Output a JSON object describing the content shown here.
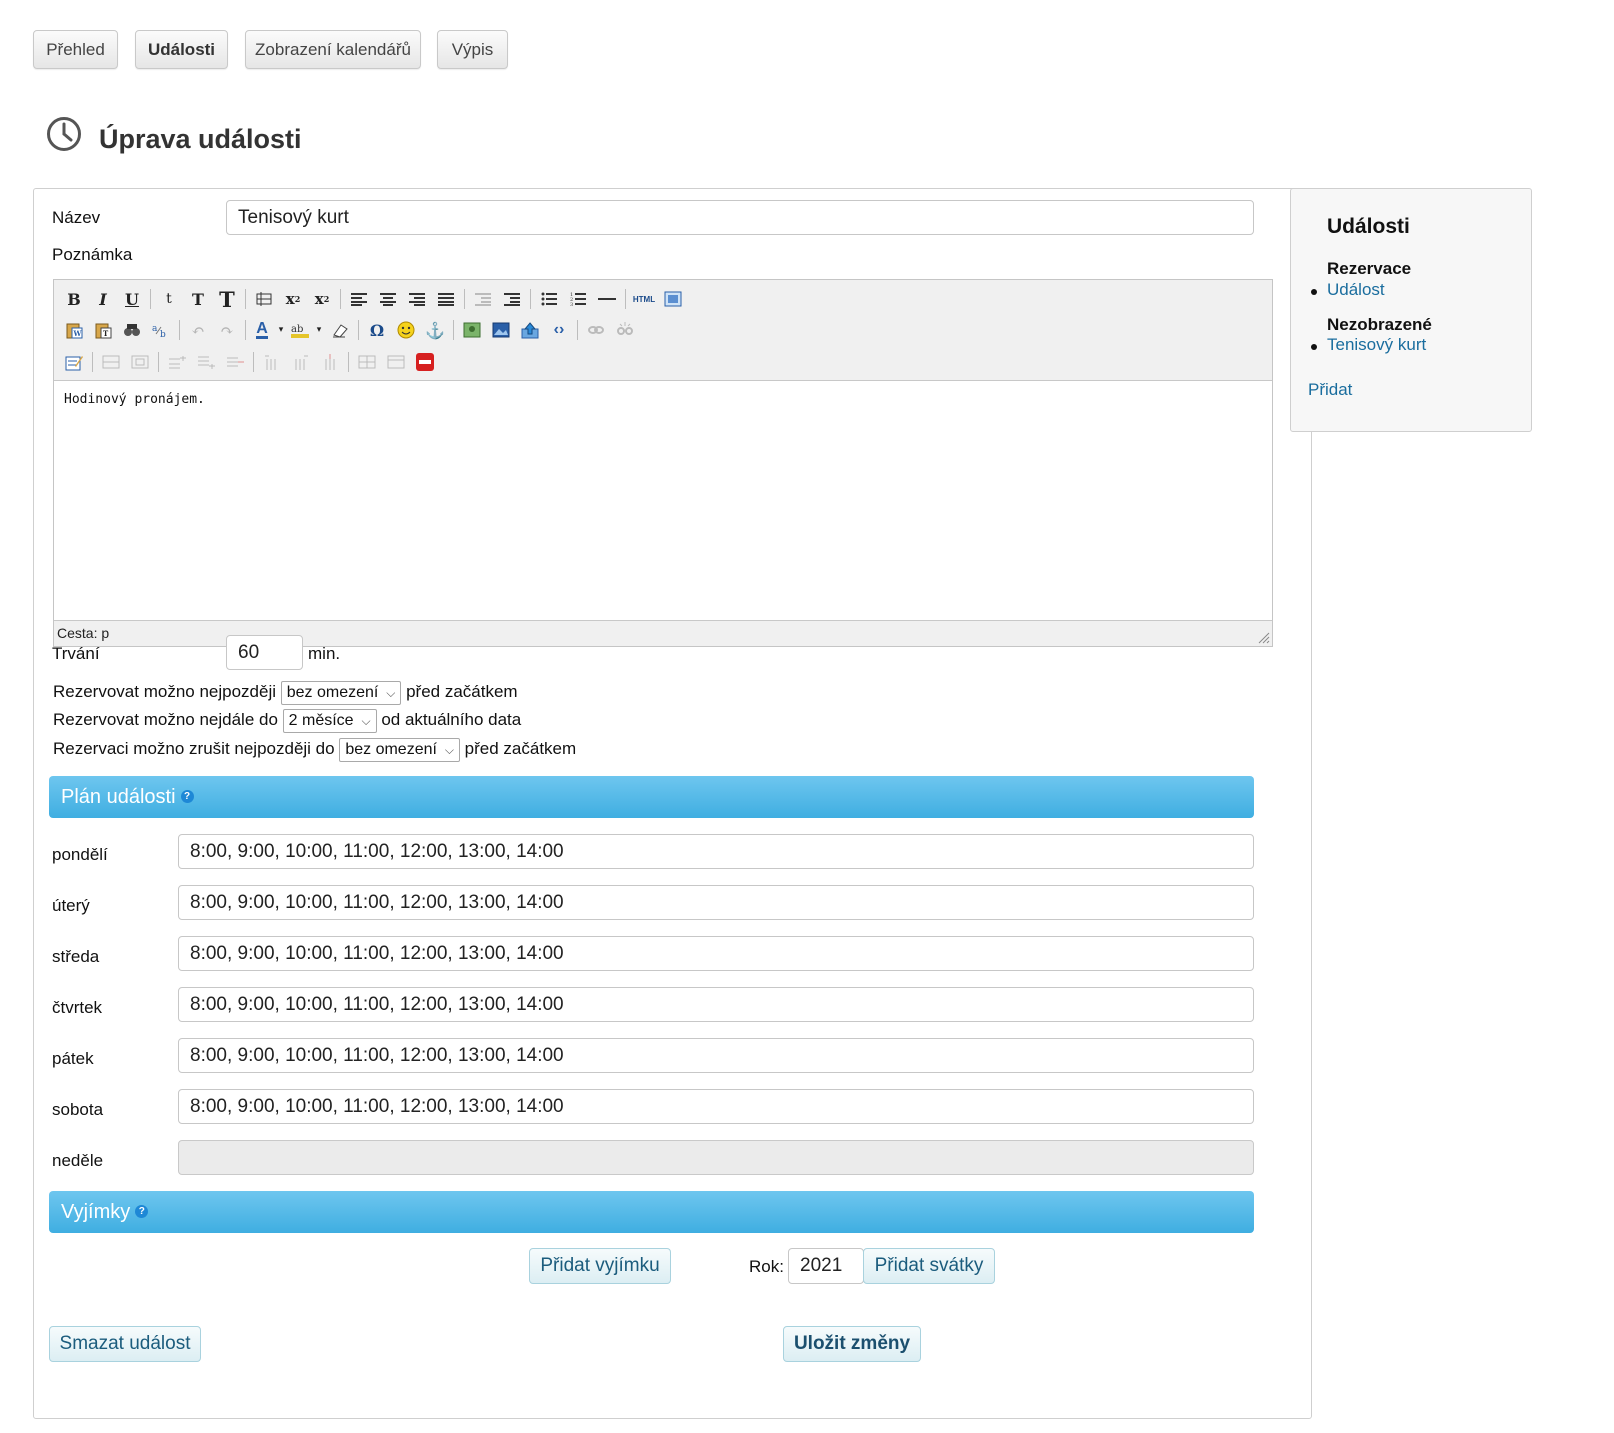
{
  "tabs": [
    {
      "label": "Přehled",
      "active": false
    },
    {
      "label": "Události",
      "active": true
    },
    {
      "label": "Zobrazení kalendářů",
      "active": false
    },
    {
      "label": "Výpis",
      "active": false
    }
  ],
  "page": {
    "title": "Úprava události",
    "icon": "clock-icon"
  },
  "form": {
    "name_label": "Název",
    "name_value": "Tenisový kurt",
    "note_label": "Poznámka",
    "editor": {
      "content": "Hodinový pronájem.",
      "status": "Cesta: p"
    },
    "duration_label": "Trvání",
    "duration_value": "60",
    "duration_unit": "min.",
    "rules": [
      {
        "before": "Rezervovat možno nejpozději",
        "selected": "bez omezení",
        "after": "před začátkem"
      },
      {
        "before": "Rezervovat možno nejdále do",
        "selected": "2 měsíce",
        "after": "od aktuálního data"
      },
      {
        "before": "Rezervaci možno zrušit nejpozději do",
        "selected": "bez omezení",
        "after": "před začátkem"
      }
    ],
    "plan_title": "Plán události",
    "plan": [
      {
        "day": "pondělí",
        "times": "8:00, 9:00, 10:00, 11:00, 12:00, 13:00, 14:00"
      },
      {
        "day": "úterý",
        "times": "8:00, 9:00, 10:00, 11:00, 12:00, 13:00, 14:00"
      },
      {
        "day": "středa",
        "times": "8:00, 9:00, 10:00, 11:00, 12:00, 13:00, 14:00"
      },
      {
        "day": "čtvrtek",
        "times": "8:00, 9:00, 10:00, 11:00, 12:00, 13:00, 14:00"
      },
      {
        "day": "pátek",
        "times": "8:00, 9:00, 10:00, 11:00, 12:00, 13:00, 14:00"
      },
      {
        "day": "sobota",
        "times": "8:00, 9:00, 10:00, 11:00, 12:00, 13:00, 14:00"
      },
      {
        "day": "neděle",
        "times": ""
      }
    ],
    "exceptions_title": "Vyjímky",
    "add_exception_label": "Přidat vyjímku",
    "year_label": "Rok:",
    "year_value": "2021",
    "add_holidays_label": "Přidat svátky",
    "delete_label": "Smazat událost",
    "save_label": "Uložit změny"
  },
  "sidebar": {
    "title": "Události",
    "groups": [
      {
        "title": "Rezervace",
        "items": [
          "Událost"
        ]
      },
      {
        "title": "Nezobrazené",
        "items": [
          "Tenisový kurt"
        ]
      }
    ],
    "add_label": "Přidat"
  },
  "colors": {
    "accent": "#3faee1",
    "link": "#1a6d9e",
    "button_text": "#1b5c7d"
  }
}
